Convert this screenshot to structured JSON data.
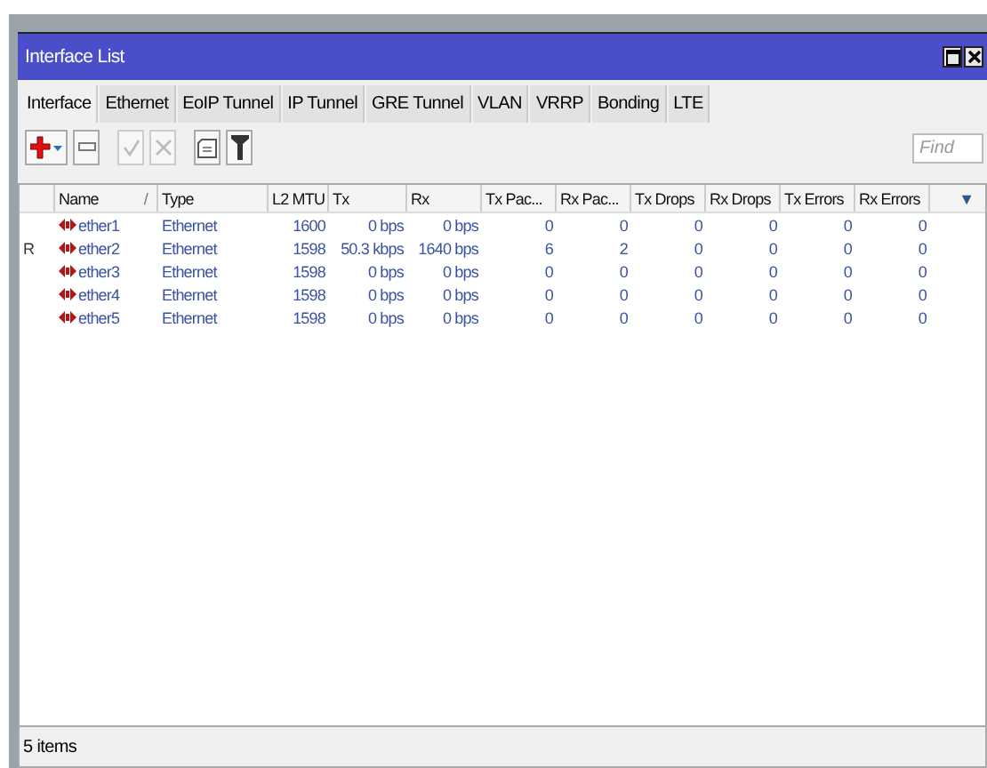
{
  "window": {
    "title": "Interface List"
  },
  "tabs": [
    {
      "label": "Interface",
      "selected": true
    },
    {
      "label": "Ethernet",
      "selected": false
    },
    {
      "label": "EoIP Tunnel",
      "selected": false
    },
    {
      "label": "IP Tunnel",
      "selected": false
    },
    {
      "label": "GRE Tunnel",
      "selected": false
    },
    {
      "label": "VLAN",
      "selected": false
    },
    {
      "label": "VRRP",
      "selected": false
    },
    {
      "label": "Bonding",
      "selected": false
    },
    {
      "label": "LTE",
      "selected": false
    }
  ],
  "toolbar": [
    {
      "kind": "add",
      "disabled": false
    },
    {
      "kind": "remove",
      "disabled": false
    },
    {
      "kind": "enable",
      "disabled": true
    },
    {
      "kind": "disable",
      "disabled": true
    },
    {
      "kind": "comment",
      "disabled": false
    },
    {
      "kind": "filter",
      "disabled": false
    }
  ],
  "search": {
    "placeholder": "Find"
  },
  "table": {
    "columns": [
      {},
      {
        "label": "Name",
        "sort_mark": "/"
      },
      {
        "label": "Type"
      },
      {
        "label": "L2 MTU"
      },
      {
        "label": "Tx"
      },
      {
        "label": "Rx"
      },
      {
        "label": "Tx Pac..."
      },
      {
        "label": "Rx Pac..."
      },
      {
        "label": "Tx Drops"
      },
      {
        "label": "Rx Drops"
      },
      {
        "label": "Tx Errors"
      },
      {
        "label": "Rx Errors"
      }
    ],
    "menu_toggle": "▼",
    "rows": [
      {
        "flag": "",
        "name": "ether1",
        "type": "Ethernet",
        "l2_mtu": "1600",
        "tx": "0 bps",
        "rx": "0 bps",
        "tx_packets": "0",
        "rx_packets": "0",
        "tx_drops": "0",
        "rx_drops": "0",
        "tx_errors": "0",
        "rx_errors": "0"
      },
      {
        "flag": "R",
        "name": "ether2",
        "type": "Ethernet",
        "l2_mtu": "1598",
        "tx": "50.3 kbps",
        "rx": "1640 bps",
        "tx_packets": "6",
        "rx_packets": "2",
        "tx_drops": "0",
        "rx_drops": "0",
        "tx_errors": "0",
        "rx_errors": "0"
      },
      {
        "flag": "",
        "name": "ether3",
        "type": "Ethernet",
        "l2_mtu": "1598",
        "tx": "0 bps",
        "rx": "0 bps",
        "tx_packets": "0",
        "rx_packets": "0",
        "tx_drops": "0",
        "rx_drops": "0",
        "tx_errors": "0",
        "rx_errors": "0"
      },
      {
        "flag": "",
        "name": "ether4",
        "type": "Ethernet",
        "l2_mtu": "1598",
        "tx": "0 bps",
        "rx": "0 bps",
        "tx_packets": "0",
        "rx_packets": "0",
        "tx_drops": "0",
        "rx_drops": "0",
        "tx_errors": "0",
        "rx_errors": "0"
      },
      {
        "flag": "",
        "name": "ether5",
        "type": "Ethernet",
        "l2_mtu": "1598",
        "tx": "0 bps",
        "rx": "0 bps",
        "tx_packets": "0",
        "rx_packets": "0",
        "tx_drops": "0",
        "rx_drops": "0",
        "tx_errors": "0",
        "rx_errors": "0"
      }
    ]
  },
  "status_bar": {
    "text": "5 items"
  }
}
